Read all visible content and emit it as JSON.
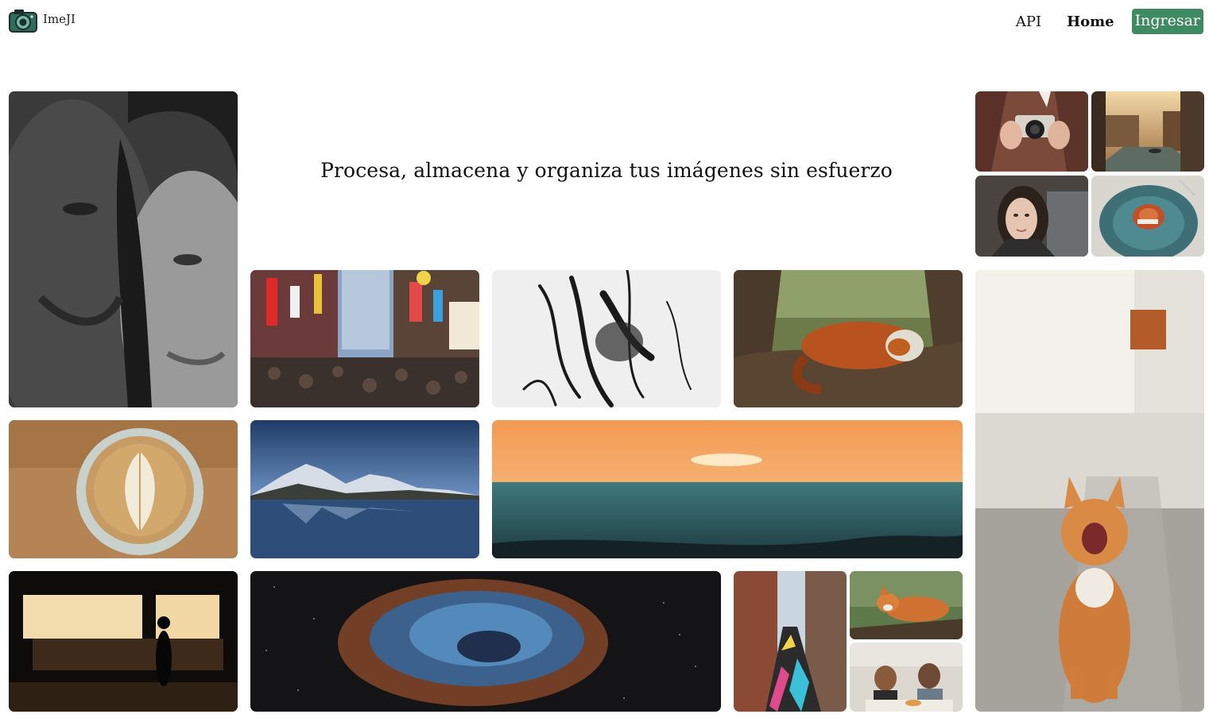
{
  "app": {
    "brand": "ImeJI",
    "logo_icon": "camera-logo-icon"
  },
  "nav": {
    "api_label": "API",
    "home_label": "Home",
    "login_label": "Ingresar",
    "login_color": "#3f8a63"
  },
  "hero": {
    "headline": "Procesa, almacena y organiza tus imágenes sin esfuerzo"
  },
  "gallery": [
    {
      "id": "couple-portrait",
      "alt": "Black and white portrait of a couple"
    },
    {
      "id": "camera-hands",
      "alt": "Person holding a camera"
    },
    {
      "id": "canal-sunset",
      "alt": "Canal with boats at sunset"
    },
    {
      "id": "woman-portrait",
      "alt": "Woman portrait"
    },
    {
      "id": "pasta-plate",
      "alt": "Plate of pasta"
    },
    {
      "id": "tokyo-street",
      "alt": "Busy street with signs"
    },
    {
      "id": "ink-strokes",
      "alt": "Black ink brush strokes"
    },
    {
      "id": "red-panda",
      "alt": "Red panda sleeping on a branch"
    },
    {
      "id": "yawning-cat",
      "alt": "Orange cat yawning"
    },
    {
      "id": "latte-art",
      "alt": "Latte art coffee cup"
    },
    {
      "id": "mountain-lake",
      "alt": "Snowy mountains reflected in a lake"
    },
    {
      "id": "ocean-sunset",
      "alt": "Sunset over the ocean"
    },
    {
      "id": "night-stall",
      "alt": "Illuminated lantern stall at night"
    },
    {
      "id": "nebula",
      "alt": "Colorful nebula in space"
    },
    {
      "id": "painted-street",
      "alt": "Street with colorful painted ground"
    },
    {
      "id": "fox",
      "alt": "Fox on a log"
    },
    {
      "id": "friends-eating",
      "alt": "Two friends eating together"
    }
  ]
}
